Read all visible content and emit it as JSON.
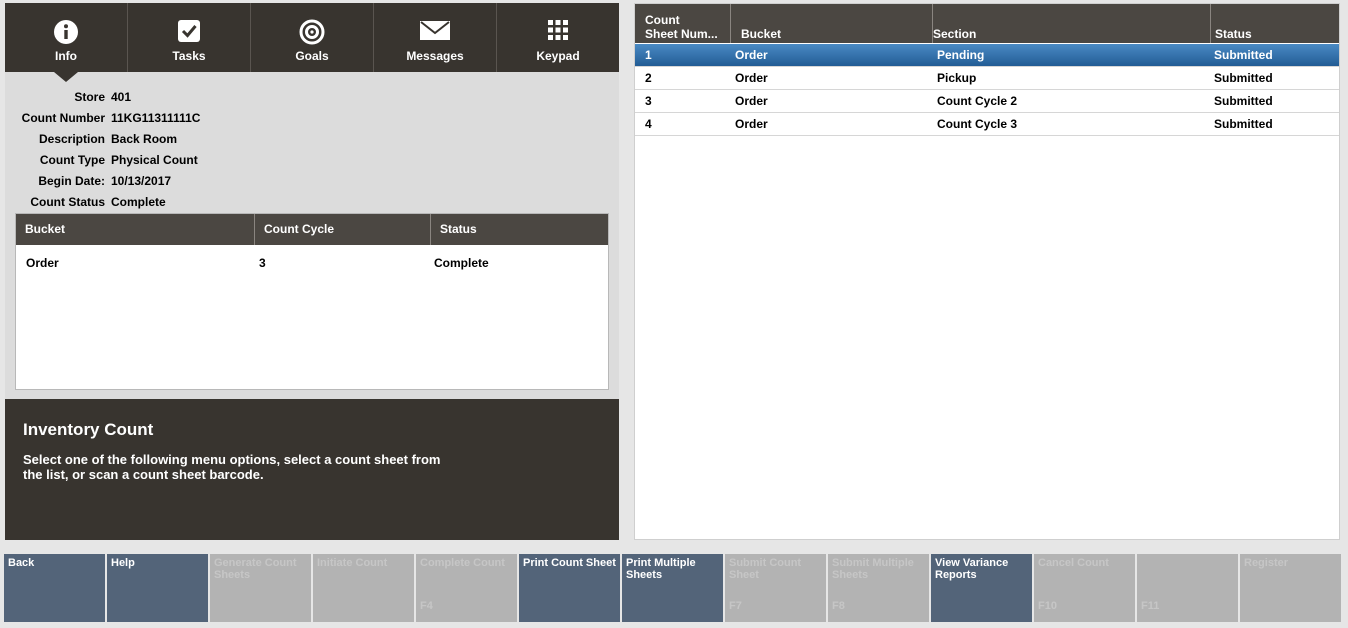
{
  "tabs": [
    {
      "label": "Info",
      "icon": "info-icon"
    },
    {
      "label": "Tasks",
      "icon": "checkbox-icon"
    },
    {
      "label": "Goals",
      "icon": "target-icon"
    },
    {
      "label": "Messages",
      "icon": "envelope-icon"
    },
    {
      "label": "Keypad",
      "icon": "keypad-icon"
    }
  ],
  "info": {
    "rows": [
      {
        "label": "Store",
        "value": "401"
      },
      {
        "label": "Count Number",
        "value": "11KG11311111C"
      },
      {
        "label": "Description",
        "value": "Back Room"
      },
      {
        "label": "Count Type",
        "value": "Physical Count"
      },
      {
        "label": "Begin Date:",
        "value": "10/13/2017"
      },
      {
        "label": "Count Status",
        "value": "Complete"
      }
    ]
  },
  "bucket_table": {
    "headers": [
      "Bucket",
      "Count Cycle",
      "Status"
    ],
    "rows": [
      {
        "bucket": "Order",
        "count_cycle": "3",
        "status": "Complete"
      }
    ]
  },
  "prompt": {
    "title": "Inventory Count",
    "text": "Select one of the following menu options, select a count sheet from the list, or scan a count sheet barcode."
  },
  "sheets_table": {
    "headers": [
      "Count\nSheet Num...",
      "Bucket",
      "Section",
      "Status"
    ],
    "rows": [
      {
        "num": "1",
        "bucket": "Order",
        "section": "Pending",
        "status": "Submitted",
        "selected": true
      },
      {
        "num": "2",
        "bucket": "Order",
        "section": "Pickup",
        "status": "Submitted",
        "selected": false
      },
      {
        "num": "3",
        "bucket": "Order",
        "section": "Count Cycle 2",
        "status": "Submitted",
        "selected": false
      },
      {
        "num": "4",
        "bucket": "Order",
        "section": "Count Cycle 3",
        "status": "Submitted",
        "selected": false
      }
    ]
  },
  "function_keys": [
    {
      "label": "Back",
      "fkey": "",
      "enabled": true
    },
    {
      "label": "Help",
      "fkey": "",
      "enabled": true
    },
    {
      "label": "Generate Count Sheets",
      "fkey": "",
      "enabled": false
    },
    {
      "label": "Initiate Count",
      "fkey": "",
      "enabled": false
    },
    {
      "label": "Complete Count",
      "fkey": "F4",
      "enabled": false
    },
    {
      "label": "Print Count Sheet",
      "fkey": "",
      "enabled": true
    },
    {
      "label": "Print Multiple Sheets",
      "fkey": "",
      "enabled": true
    },
    {
      "label": "Submit Count Sheet",
      "fkey": "F7",
      "enabled": false
    },
    {
      "label": "Submit Multiple Sheets",
      "fkey": "F8",
      "enabled": false
    },
    {
      "label": "View Variance Reports",
      "fkey": "",
      "enabled": true
    },
    {
      "label": "Cancel Count",
      "fkey": "F10",
      "enabled": false
    },
    {
      "label": "",
      "fkey": "F11",
      "enabled": false
    },
    {
      "label": "Register",
      "fkey": "",
      "enabled": false
    }
  ]
}
